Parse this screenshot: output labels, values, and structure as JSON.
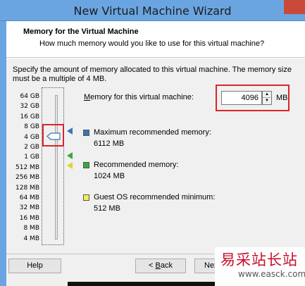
{
  "window": {
    "title": "New Virtual Machine Wizard"
  },
  "header": {
    "title": "Memory for the Virtual Machine",
    "subtitle": "How much memory would you like to use for this virtual machine?"
  },
  "description": "Specify the amount of memory allocated to this virtual machine. The memory size must be a multiple of 4 MB.",
  "scale": [
    "64 GB",
    "32 GB",
    "16 GB",
    "8 GB",
    "4 GB",
    "2 GB",
    "1 GB",
    "512 MB",
    "256 MB",
    "128 MB",
    "64 MB",
    "32 MB",
    "16 MB",
    "8 MB",
    "4 MB"
  ],
  "memory": {
    "label_prefix": "M",
    "label_rest": "emory for this virtual machine:",
    "value": "4096",
    "unit": "MB"
  },
  "legend": {
    "max": {
      "label": "Maximum recommended memory:",
      "value": "6112 MB",
      "color": "#3c73b8"
    },
    "rec": {
      "label": "Recommended memory:",
      "value": "1024 MB",
      "color": "#39a83a"
    },
    "min": {
      "label": "Guest OS recommended minimum:",
      "value": "512 MB",
      "color": "#e0d42a"
    }
  },
  "buttons": {
    "help": "Help",
    "back_prefix": "< ",
    "back_accel": "B",
    "back_rest": "ack",
    "next": "Next"
  },
  "watermark": {
    "text": "易采站长站",
    "url": "www.easck.com"
  }
}
